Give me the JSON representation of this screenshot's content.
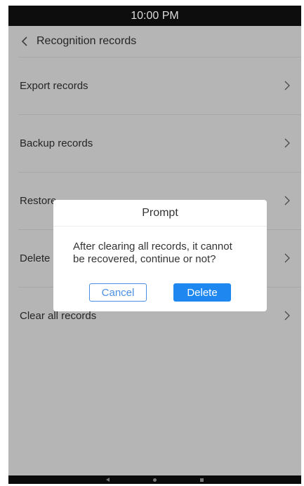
{
  "status_bar": {
    "time": "10:00 PM"
  },
  "header": {
    "back_icon": "chevron-left-icon",
    "title": "Recognition records"
  },
  "menu": {
    "items": [
      {
        "label": "Export records",
        "icon": "chevron-right-icon"
      },
      {
        "label": "Backup records",
        "icon": "chevron-right-icon"
      },
      {
        "label": "Restore",
        "icon": "chevron-right-icon"
      },
      {
        "label": "Delete",
        "icon": "chevron-right-icon"
      },
      {
        "label": "Clear all records",
        "icon": "chevron-right-icon"
      }
    ]
  },
  "dialog": {
    "title": "Prompt",
    "message_line1": "After clearing all records, it cannot",
    "message_line2": "be recovered, continue or not?",
    "cancel_label": "Cancel",
    "delete_label": "Delete"
  },
  "nav_bar": {
    "back_icon": "triangle-back-icon",
    "home_icon": "circle-home-icon",
    "recent_icon": "square-recent-icon"
  },
  "colors": {
    "accent": "#1e88f0",
    "cancel_border": "#4a90e2",
    "status_bar_bg": "#0d0d0d",
    "screen_bg": "#f4f4f4"
  }
}
